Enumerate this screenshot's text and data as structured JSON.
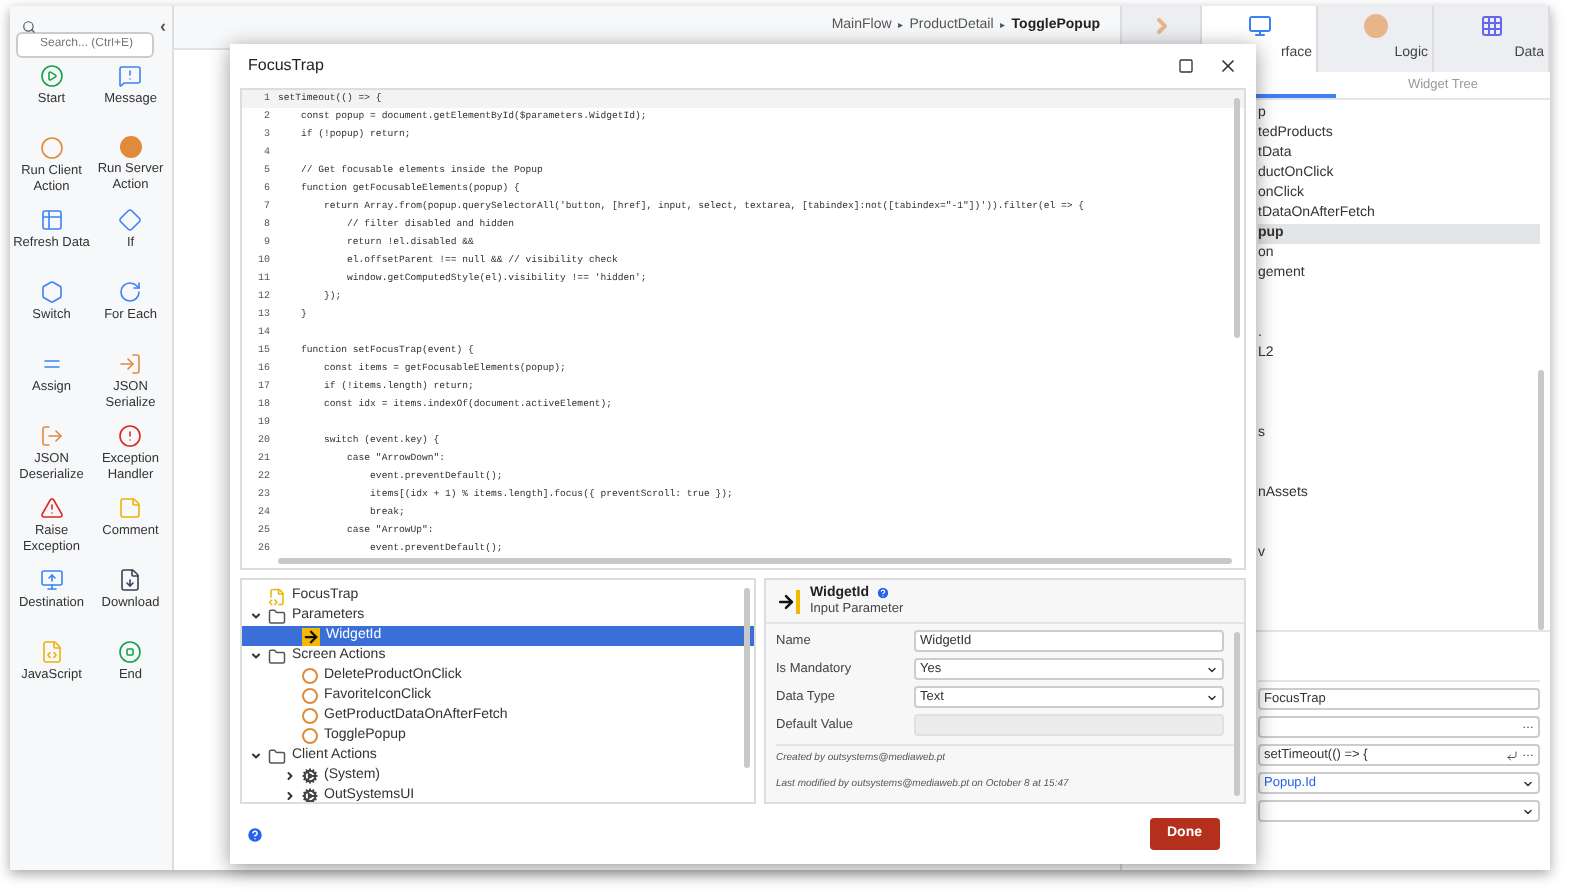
{
  "toolbox": {
    "search": {
      "placeholder": "Search... (Ctrl+E)"
    },
    "collapse": "‹",
    "tools": [
      {
        "label": "Start"
      },
      {
        "label": "Message"
      },
      {
        "label": "Run Client Action"
      },
      {
        "label": "Run Server Action"
      },
      {
        "label": "Refresh Data"
      },
      {
        "label": "If"
      },
      {
        "label": "Switch"
      },
      {
        "label": "For Each"
      },
      {
        "label": "Assign"
      },
      {
        "label": "JSON Serialize"
      },
      {
        "label": "JSON Deserialize"
      },
      {
        "label": "Exception Handler"
      },
      {
        "label": "Raise Exception"
      },
      {
        "label": "Comment"
      },
      {
        "label": "Destination"
      },
      {
        "label": "Download"
      },
      {
        "label": "JavaScript"
      },
      {
        "label": "End"
      }
    ]
  },
  "breadcrumb": [
    {
      "label": "MainFlow",
      "current": false
    },
    {
      "label": "ProductDetail",
      "current": false
    },
    {
      "label": "TogglePopup",
      "current": true
    }
  ],
  "breadcrumb_separator": "▸",
  "right_panel": {
    "tabs": [
      {
        "kind": "process",
        "selected": false
      },
      {
        "label": "rface",
        "kind": "interface",
        "selected": true
      },
      {
        "label": "Logic",
        "kind": "logic",
        "selected": false
      },
      {
        "label": "Data",
        "kind": "data",
        "selected": false
      }
    ],
    "subtabs": [
      {
        "selected": true
      },
      {
        "label": "Widget Tree",
        "selected": false
      }
    ],
    "tree": [
      {
        "label": "p",
        "selected": false
      },
      {
        "label": "tedProducts",
        "selected": false
      },
      {
        "label": "tData",
        "selected": false
      },
      {
        "label": "ductOnClick",
        "selected": false
      },
      {
        "label": "onClick",
        "selected": false
      },
      {
        "label": "tDataOnAfterFetch",
        "selected": false
      },
      {
        "label": "pup",
        "selected": true
      },
      {
        "label": "on",
        "selected": false
      },
      {
        "label": "gement",
        "selected": false
      },
      {
        "label": ".",
        "selected": false
      },
      {
        "label": "L2",
        "selected": false
      },
      {
        "label": "s",
        "selected": false
      },
      {
        "label": "nAssets",
        "selected": false
      },
      {
        "label": "v",
        "selected": false
      }
    ],
    "properties": [
      {
        "kind": "text",
        "value": "FocusTrap"
      },
      {
        "kind": "more",
        "more": "…"
      },
      {
        "kind": "code",
        "value": "setTimeout(() => {",
        "more": "…"
      },
      {
        "kind": "select",
        "value": "Popup.Id"
      },
      {
        "kind": "select"
      }
    ]
  },
  "dialog": {
    "title": "FocusTrap",
    "code_lines": [
      {
        "number": "1",
        "text": "setTimeout(() => {"
      },
      {
        "number": "2",
        "text": "    const popup = document.getElementById($parameters.WidgetId);"
      },
      {
        "number": "3",
        "text": "    if (!popup) return;"
      },
      {
        "number": "4"
      },
      {
        "number": "5",
        "text": "    // Get focusable elements inside the Popup"
      },
      {
        "number": "6",
        "text": "    function getFocusableElements(popup) {"
      },
      {
        "number": "7",
        "text": "        return Array.from(popup.querySelectorAll('button, [href], input, select, textarea, [tabindex]:not([tabindex=\"-1\"])')).filter(el => {"
      },
      {
        "number": "8",
        "text": "            // filter disabled and hidden"
      },
      {
        "number": "9",
        "text": "            return !el.disabled &&"
      },
      {
        "number": "10",
        "text": "            el.offsetParent !== null && // visibility check"
      },
      {
        "number": "11",
        "text": "            window.getComputedStyle(el).visibility !== 'hidden';"
      },
      {
        "number": "12",
        "text": "        });"
      },
      {
        "number": "13",
        "text": "    }"
      },
      {
        "number": "14"
      },
      {
        "number": "15",
        "text": "    function setFocusTrap(event) {"
      },
      {
        "number": "16",
        "text": "        const items = getFocusableElements(popup);"
      },
      {
        "number": "17",
        "text": "        if (!items.length) return;"
      },
      {
        "number": "18",
        "text": "        const idx = items.indexOf(document.activeElement);"
      },
      {
        "number": "19"
      },
      {
        "number": "20",
        "text": "        switch (event.key) {"
      },
      {
        "number": "21",
        "text": "            case \"ArrowDown\":"
      },
      {
        "number": "22",
        "text": "                event.preventDefault();"
      },
      {
        "number": "23",
        "text": "                items[(idx + 1) % items.length].focus({ preventScroll: true });"
      },
      {
        "number": "24",
        "text": "                break;"
      },
      {
        "number": "25",
        "text": "            case \"ArrowUp\":"
      },
      {
        "number": "26",
        "text": "                event.preventDefault();"
      }
    ],
    "tree": [
      {
        "label": "FocusTrap",
        "kind": "script",
        "selected": false
      },
      {
        "label": "Parameters",
        "kind": "folder",
        "selected": false,
        "expanded": true,
        "children": [
          {
            "label": "WidgetId",
            "kind": "param",
            "selected": true
          }
        ]
      },
      {
        "label": "Screen Actions",
        "kind": "folder",
        "selected": false,
        "expanded": true,
        "children": [
          {
            "label": "DeleteProductOnClick",
            "kind": "action",
            "selected": false
          },
          {
            "label": "FavoriteIconClick",
            "kind": "action",
            "selected": false
          },
          {
            "label": "GetProductDataOnAfterFetch",
            "kind": "action",
            "selected": false
          },
          {
            "label": "TogglePopup",
            "kind": "action",
            "selected": false
          }
        ]
      },
      {
        "label": "Client Actions",
        "kind": "folder",
        "selected": false,
        "expanded": true,
        "children": [
          {
            "label": "(System)",
            "kind": "module",
            "selected": false,
            "expanded": false
          },
          {
            "label": "OutSystemsUI",
            "kind": "module",
            "selected": false,
            "expanded": false
          }
        ]
      }
    ],
    "details": {
      "title": "WidgetId",
      "subtitle": "Input Parameter",
      "fields": [
        {
          "label": "Name",
          "kind": "text",
          "value": "WidgetId",
          "disabled": false
        },
        {
          "label": "Is Mandatory",
          "kind": "select",
          "value": "Yes",
          "disabled": false
        },
        {
          "label": "Data Type",
          "kind": "select",
          "value": "Text",
          "disabled": false
        },
        {
          "label": "Default Value",
          "kind": "text",
          "disabled": true
        }
      ],
      "created": "Created by outsystems@mediaweb.pt",
      "modified": "Last modified by outsystems@mediaweb.pt on October 8 at 15:47"
    },
    "done": "Done"
  }
}
